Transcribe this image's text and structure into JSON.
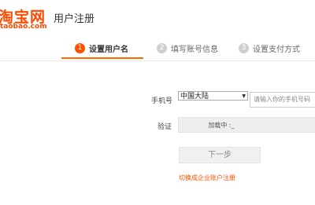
{
  "header": {
    "logo_main": "淘宝网",
    "logo_sub": "taobao.com",
    "title": "用户注册"
  },
  "steps": [
    {
      "num": "1",
      "label": "设置用户名",
      "state": "active"
    },
    {
      "num": "2",
      "label": "填写账号信息",
      "state": "inactive"
    },
    {
      "num": "3",
      "label": "设置支付方式",
      "state": "inactive"
    }
  ],
  "form": {
    "phone_label": "手机号",
    "country_value": "中国大陆",
    "phone_placeholder": "请输入你的手机号码",
    "verify_label": "验证",
    "captcha_text": "加载中 :_"
  },
  "actions": {
    "next_label": "下一步",
    "switch_link": "切换成企业账户注册"
  },
  "colors": {
    "brand": "#ff5000",
    "step_inactive": "#cfcfcf"
  }
}
